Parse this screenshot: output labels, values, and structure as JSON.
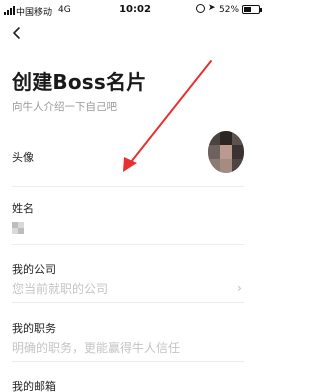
{
  "status_bar": {
    "carrier": "中国移动",
    "network": "4G",
    "time": "10:02",
    "battery": "52%",
    "battery_level": 0.52
  },
  "header": {
    "title": "创建Boss名片",
    "subtitle": "向牛人介绍一下自己吧"
  },
  "form": {
    "avatar_label": "头像",
    "name_label": "姓名",
    "company_label": "我的公司",
    "company_placeholder": "您当前就职的公司",
    "position_label": "我的职务",
    "position_placeholder": "明确的职务，更能赢得牛人信任",
    "email_label": "我的邮箱"
  },
  "annotation": {
    "arrow_color": "#e8312f"
  }
}
